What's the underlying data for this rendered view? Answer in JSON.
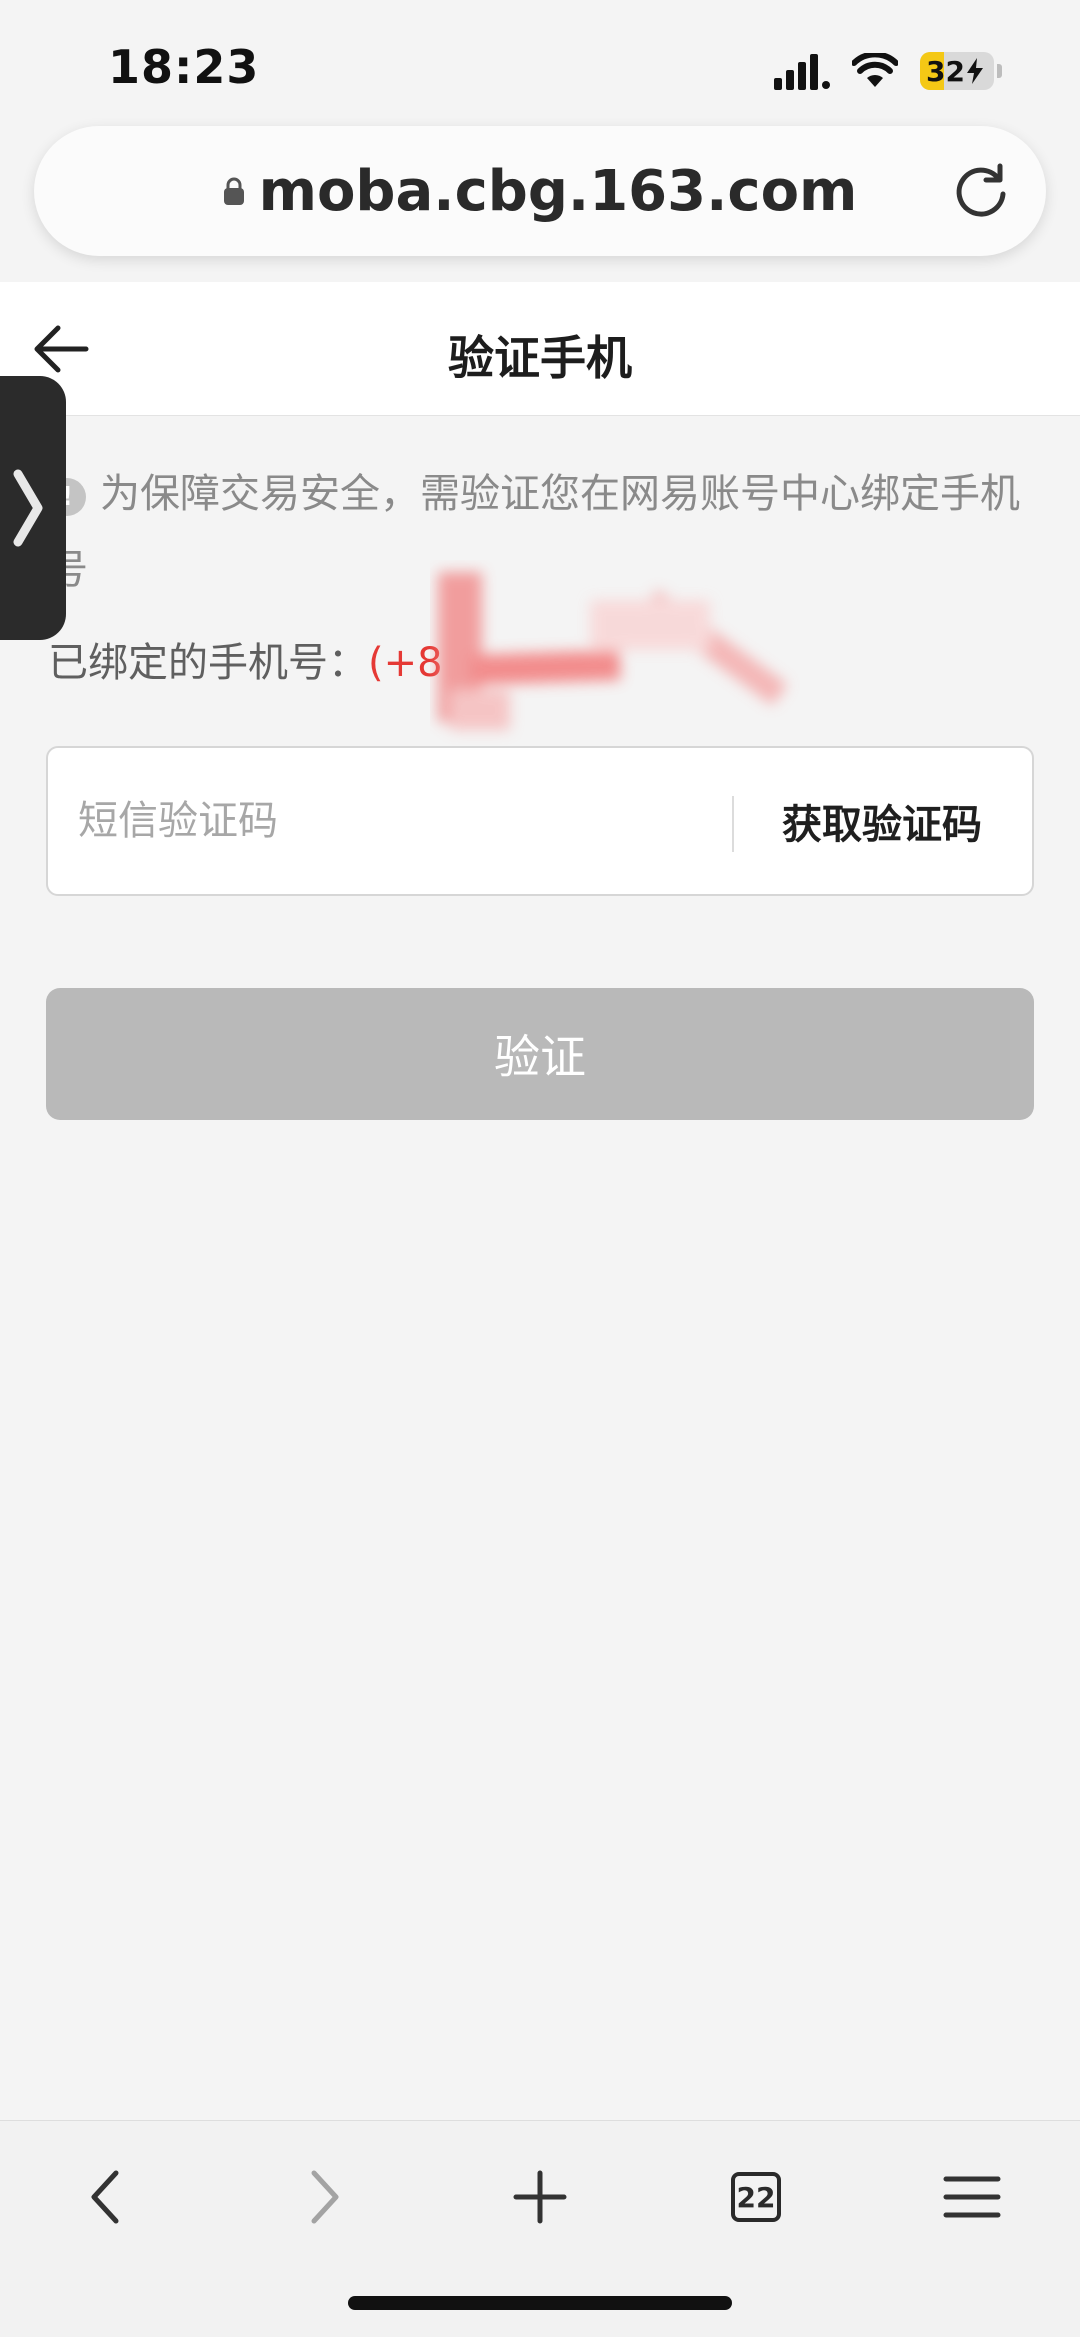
{
  "status_bar": {
    "time": "18:23",
    "battery_level": "32",
    "battery_fraction": 0.32,
    "battery_color": "#f4c815",
    "icons": [
      "signal-icon",
      "wifi-icon",
      "battery-charging-icon"
    ]
  },
  "browser": {
    "url": "moba.cbg.163.com",
    "lock_icon": "lock-icon",
    "reload_icon": "reload-icon",
    "open_tabs": "22"
  },
  "header": {
    "title": "验证手机",
    "back_icon": "back-arrow-icon"
  },
  "side_tab": {
    "icon": "chevron-right-icon"
  },
  "notice": {
    "icon_glyph": "!",
    "text": "为保障交易安全，需验证您在网易账号中心绑定手机号"
  },
  "bound_phone": {
    "label": "已绑定的手机号：",
    "value": "(+8"
  },
  "sms_code": {
    "placeholder": "短信验证码",
    "get_code_label": "获取验证码"
  },
  "verify_button": {
    "label": "验证",
    "color": "#b9b9b9"
  },
  "colors": {
    "accent_red": "#e53935",
    "background": "#f4f4f4"
  },
  "toolbar": {
    "items": [
      "back-icon",
      "forward-icon",
      "new-tab-icon",
      "tabs-icon",
      "menu-icon"
    ]
  }
}
